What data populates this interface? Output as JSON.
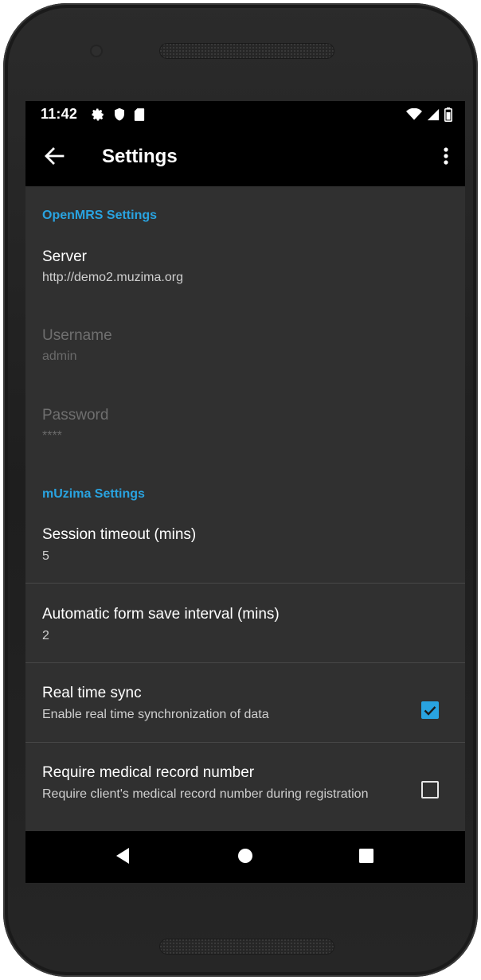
{
  "status_bar": {
    "time": "11:42",
    "left_icons": [
      "settings-icon",
      "shield-icon",
      "sd-card-icon"
    ],
    "right_icons": [
      "wifi-icon",
      "signal-icon",
      "battery-icon"
    ]
  },
  "app_bar": {
    "title": "Settings",
    "back_icon": "arrow-back-icon",
    "menu_icon": "more-vert-icon"
  },
  "sections": [
    {
      "header": "OpenMRS Settings",
      "items": [
        {
          "title": "Server",
          "summary": "http://demo2.muzima.org",
          "enabled": true
        },
        {
          "title": "Username",
          "summary": "admin",
          "enabled": false
        },
        {
          "title": "Password",
          "summary": "****",
          "enabled": false
        }
      ]
    },
    {
      "header": "mUzima Settings",
      "items": [
        {
          "title": "Session timeout (mins)",
          "summary": "5",
          "enabled": true
        },
        {
          "title": "Automatic form save interval (mins)",
          "summary": "2",
          "enabled": true
        },
        {
          "title": "Real time sync",
          "summary": "Enable real time synchronization of data",
          "enabled": true,
          "checked": true
        },
        {
          "title": "Require medical record number",
          "summary": "Require client's medical record number during registration",
          "enabled": true,
          "checked": false
        }
      ]
    }
  ],
  "nav_bar": {
    "icons": [
      "back-triangle-icon",
      "home-circle-icon",
      "recents-square-icon"
    ]
  },
  "colors": {
    "accent": "#29a3e0",
    "background": "#303030",
    "bars": "#000000"
  }
}
